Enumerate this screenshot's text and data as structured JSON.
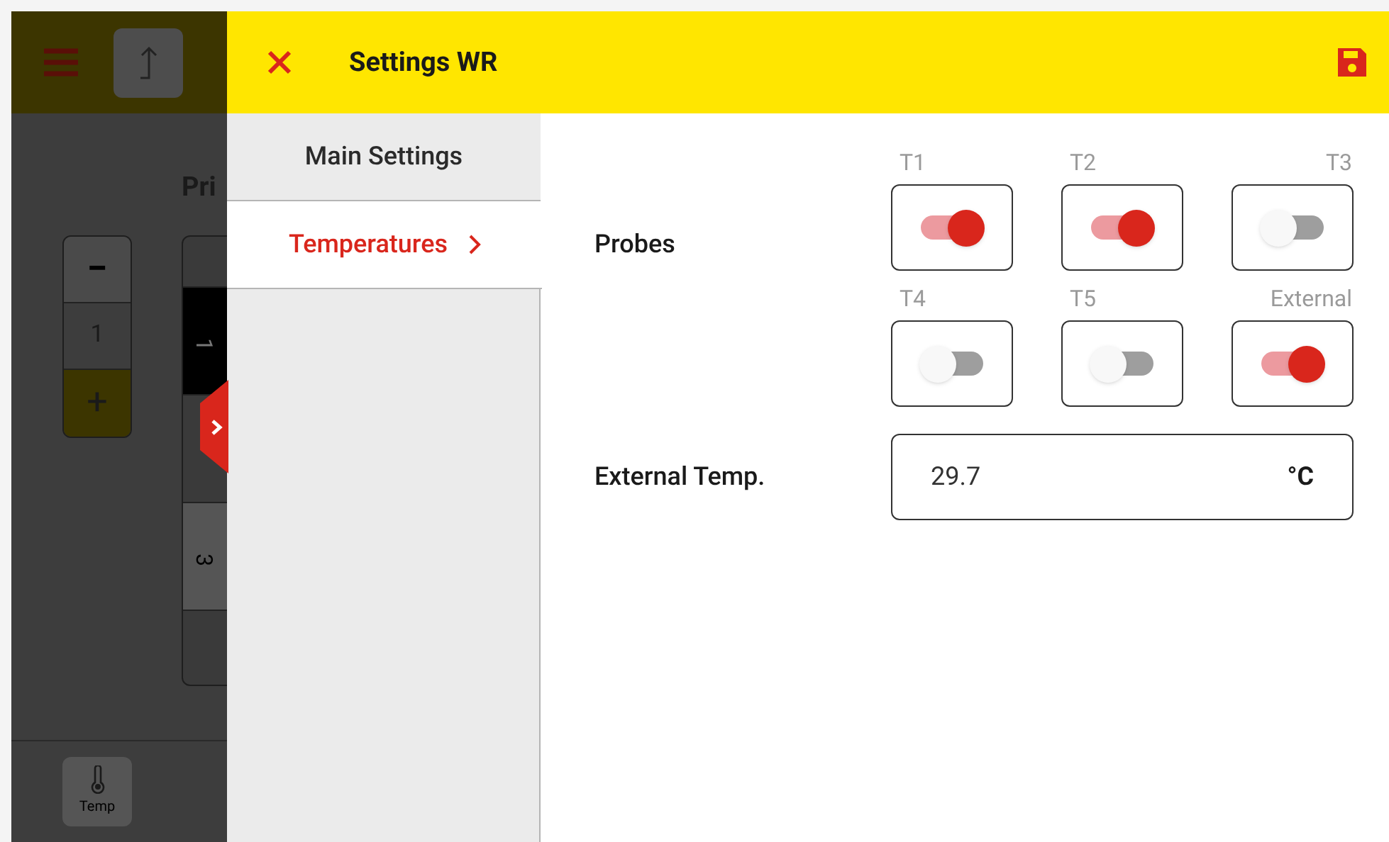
{
  "background_app": {
    "heading": "Pri",
    "stepper": {
      "minus": "−",
      "value": "1",
      "plus": "+"
    },
    "tabs": [
      {
        "label": "1",
        "selected": true
      },
      {
        "label": "3",
        "selected": false
      }
    ],
    "bottom_button": "Temp"
  },
  "drawer": {
    "title": "Settings WR",
    "menu": [
      {
        "label": "Main Settings",
        "selected": false
      },
      {
        "label": "Temperatures",
        "selected": true
      }
    ],
    "probes_label": "Probes",
    "probes": [
      {
        "label": "T1",
        "on": true
      },
      {
        "label": "T2",
        "on": true
      },
      {
        "label": "T3",
        "on": false
      },
      {
        "label": "T4",
        "on": false
      },
      {
        "label": "T5",
        "on": false
      },
      {
        "label": "External",
        "on": true
      }
    ],
    "external_temp": {
      "label": "External Temp.",
      "value": "29.7",
      "unit": "°C"
    }
  }
}
